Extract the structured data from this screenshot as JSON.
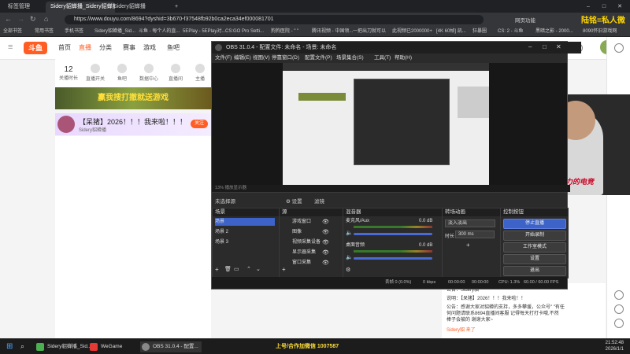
{
  "browser": {
    "tabs": [
      {
        "label": "标签管理"
      },
      {
        "label": "Sidery貂蝉播_Sidery貂蝉播"
      },
      {
        "label": "Sidery貂蝉播"
      }
    ],
    "new_tab": "+",
    "url": "https://www.douyu.com/8694?dyshid=3b670-f37548fb92b0ca2eca34ef000081701",
    "bookmarks": [
      "全部书签",
      "常用书签",
      "手机书签",
      "Sidery貂蝉播_Sid...",
      "斗鱼 - 每个人的直...",
      "5EPlay - 5EPlay对...",
      "CS:GO Pro Setti...",
      "狗狗医院 - \" \"",
      "腾讯视频 - 中国领...",
      "一把出刀就可以",
      "此视频已2000000+",
      "[4K 60帧] 凯...",
      "狂暴圈",
      "CS: 2 - 斗鱼",
      "黑暗之影 - 2000...",
      "8090怀旧游戏网"
    ],
    "top_right_label": "网页功能",
    "watermark": "陆铭=私人微信"
  },
  "douyu": {
    "logo": "斗鱼",
    "nav": [
      "首页",
      "直播",
      "分类",
      "赛事",
      "游戏",
      "鱼吧"
    ],
    "nav_active": 1,
    "subnav": [
      {
        "num": "12",
        "label": "关播时长"
      },
      {
        "label": "直播开关"
      },
      {
        "label": "鱼吧"
      },
      {
        "label": "数据中心"
      },
      {
        "label": "直播间"
      },
      {
        "label": "主播"
      }
    ],
    "banner_text": "赢我搜打撤就送游戏",
    "chat_title": "【呆猪】2026！！！我来啦！！！",
    "chat_sub": "Sidery貂蝉播",
    "chat_btn": "关注",
    "chat_lines": [
      "公告：Sidery貂",
      "说明：【呆猪】2026！！！我来啦！！",
      "公告：感谢大家对貂蝉的支持，多多攀援，公众号\" \"有任",
      "何问题请联系8694直播间客服 记得每天打打卡哦,不然",
      "棒子会被的 谢谢大家~",
      "Sidery貂 来了"
    ],
    "right_icons": [
      "消息",
      "历史",
      "下载",
      "更多"
    ]
  },
  "obs": {
    "title": "OBS 31.0.4 - 配置文件: 未命名 - 场景: 未命名",
    "menu": [
      "文件(F)",
      "编辑(E)",
      "视图(V)",
      "停靠窗口(D)",
      "配置文件(P)",
      "场景集合(S)",
      "工具(T)",
      "帮助(H)"
    ],
    "status_text": "13%  播放显示器",
    "scene_selected_label": "未选择源",
    "props_btn": "⚙ 设置",
    "filter_btn": "滤镜",
    "docks": {
      "scenes": {
        "title": "场景",
        "items": [
          "场景",
          "场景 2",
          "场景 3"
        ],
        "selected": 0
      },
      "sources": {
        "title": "源",
        "items": [
          "游戏窗口",
          "图像",
          "视频采集设备",
          "显示器采集",
          "窗口采集"
        ]
      },
      "mixer": {
        "title": "混音器",
        "tracks": [
          {
            "name": "麦克风/Aux",
            "db": "0.0 dB",
            "level": 0.9
          },
          {
            "name": "桌面音频",
            "db": "0.0 dB",
            "level": 0.9
          }
        ]
      },
      "transitions": {
        "title": "转场动画",
        "type": "淡入淡出",
        "duration_label": "时长",
        "duration": "300 ms"
      },
      "controls": {
        "title": "控制按钮",
        "buttons": [
          "停止直播",
          "开始录制",
          "工作室模式",
          "设置",
          "退出"
        ]
      }
    },
    "statusbar": {
      "dropped": "丢帧 0 (0.0%)",
      "kbps": "0 kbps",
      "rec": "00:00:00",
      "live": "00:00:00",
      "cpu": "CPU: 1.3%",
      "fps": "60.00 / 60.00 FPS"
    }
  },
  "stream": {
    "overlay_text": "战斗力的电竞"
  },
  "taskbar": {
    "items": [
      "Sidery貂蝉播_Sid...",
      "WeGame",
      "OBS 31.0.4 - 配置..."
    ],
    "ticker": "上号/合作加微信 1007587",
    "time": "21:52:48",
    "date": "2026/1/1"
  },
  "colors": {
    "accent": "#ff5d23",
    "obs_blue": "#3d63c8"
  }
}
